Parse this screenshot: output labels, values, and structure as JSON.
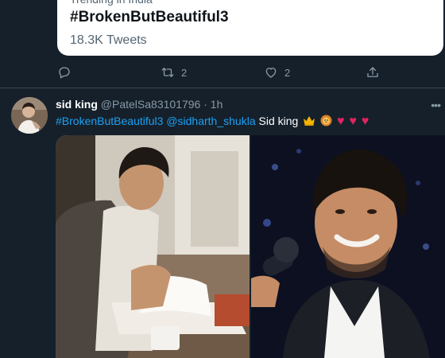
{
  "trend_card": {
    "label": "Trending in India",
    "hashtag": "#BrokenButBeautiful3",
    "count": "18.3K Tweets"
  },
  "actions": {
    "reply_icon": "reply-icon",
    "retweet_icon": "retweet-icon",
    "retweet_count": "2",
    "like_icon": "heart-icon",
    "like_count": "2",
    "share_icon": "share-icon"
  },
  "tweet": {
    "display_name": "sid king",
    "handle": "@PatelSa83101796",
    "separator": "·",
    "time": "1h",
    "more": "•••",
    "hashtag": "#BrokenButBeautiful3",
    "mention": "@sidharth_shukla",
    "text": "Sid king",
    "emojis": [
      "crown-emoji",
      "lion-emoji",
      "red-heart",
      "red-heart",
      "red-heart"
    ],
    "heart_glyph": "♥"
  },
  "colors": {
    "background": "#15202b",
    "link": "#1da1f2",
    "muted": "#8899a6",
    "heart": "#e0245e",
    "divider": "#38444d"
  }
}
